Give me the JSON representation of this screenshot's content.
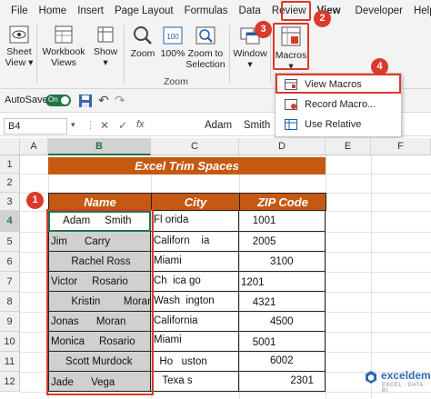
{
  "ribbon_tabs": [
    "File",
    "Home",
    "Insert",
    "Page Layout",
    "Formulas",
    "Data",
    "Review",
    "View",
    "Developer",
    "Help"
  ],
  "active_tab": "View",
  "ribbon": {
    "sheet_view": "Sheet View",
    "workbook_views": "Workbook Views",
    "show": "Show",
    "zoom": "Zoom",
    "zoom100": "100%",
    "zoom_to_selection": "Zoom to Selection",
    "zoom_group": "Zoom",
    "window": "Window",
    "macros": "Macros"
  },
  "autosave": {
    "label": "AutoSave",
    "state": "On"
  },
  "formula_bar": {
    "cell_ref": "B4",
    "value": "Adam    Smith"
  },
  "macros_menu": {
    "items": [
      "View Macros",
      "Record Macro...",
      "Use Relative References"
    ],
    "highlighted": "View Macros"
  },
  "columns": [
    "A",
    "B",
    "C",
    "D",
    "E",
    "F"
  ],
  "rows": [
    "1",
    "2",
    "3",
    "4",
    "5",
    "6",
    "7",
    "8",
    "9",
    "10",
    "11",
    "12"
  ],
  "sheet": {
    "title": "Excel Trim Spaces",
    "headers": {
      "name": "Name",
      "city": "City",
      "zip": "ZIP Code"
    },
    "data": [
      {
        "name": "    Adam     Smith",
        "city": "Fl orida",
        "zip": "    1001"
      },
      {
        "name": "Jim      Carry",
        "city": "Californ    ia",
        "zip": "    2005"
      },
      {
        "name": "       Rachel Ross",
        "city": "Miami",
        "zip": "          3100"
      },
      {
        "name": "Victor     Rosario",
        "city": "Ch  ica go",
        "zip": "1201"
      },
      {
        "name": "       Kristin        Moran",
        "city": "Wash  ington",
        "zip": "    4321"
      },
      {
        "name": "Jonas      Moran",
        "city": "California",
        "zip": "          4500"
      },
      {
        "name": "Monica     Rosario",
        "city": "Miami",
        "zip": "    5001"
      },
      {
        "name": "     Scott Murdock",
        "city": "  Ho   uston",
        "zip": "          6002"
      },
      {
        "name": "Jade      Vega",
        "city": "   Texa s",
        "zip": "                 2301"
      }
    ]
  },
  "callouts": [
    "1",
    "2",
    "3",
    "4"
  ],
  "watermark": {
    "brand": "exceldemy",
    "tagline": "EXCEL · DATA · BI"
  },
  "colors": {
    "accent": "#c65911",
    "highlight": "#d93a2b",
    "excel_green": "#217346"
  }
}
